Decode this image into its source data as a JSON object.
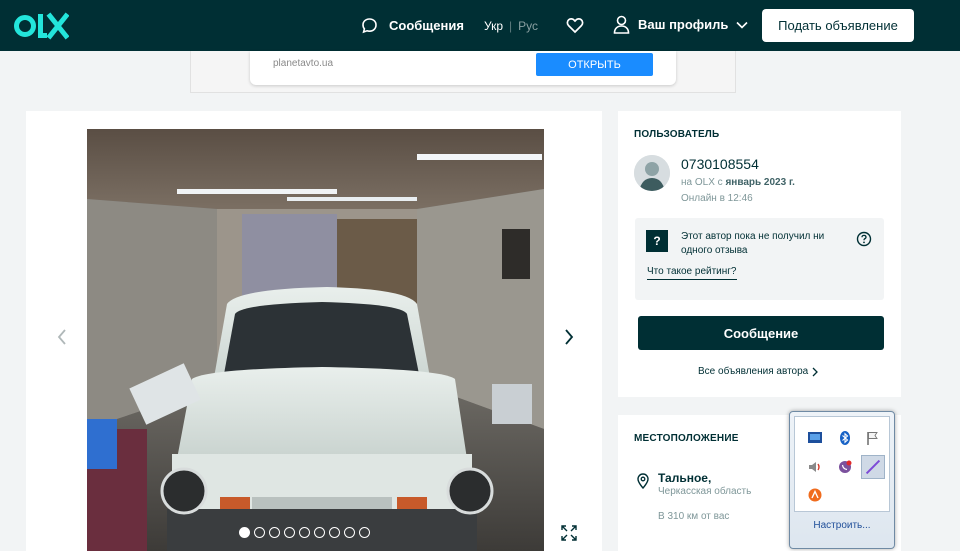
{
  "header": {
    "logo_text": "OLX",
    "messages_label": "Сообщения",
    "lang_ukr": "Укр",
    "lang_sep": "|",
    "lang_rus": "Рус",
    "profile_label": "Ваш профиль",
    "post_ad_label": "Подать объявление"
  },
  "ad_banner": {
    "site": "planetavto.ua",
    "open_label": "ОТКРЫТЬ"
  },
  "gallery": {
    "photo_count": 9,
    "active_index": 0
  },
  "user_card": {
    "title": "ПОЛЬЗОВАТЕЛЬ",
    "phone": "0730108554",
    "since_prefix": "на OLX с",
    "since_date": "январь 2023 г.",
    "online": "Онлайн в 12:46",
    "rating_badge": "?",
    "rating_text": "Этот автор пока не получил ни одного отзыва",
    "rating_link": "Что такое рейтинг?",
    "message_label": "Сообщение",
    "all_ads_label": "Все объявления автора"
  },
  "location_card": {
    "title": "МЕСТОПОЛОЖЕНИЕ",
    "city": "Тальное,",
    "region": "Черкасская область",
    "distance": "В 310 км от вас"
  },
  "tray": {
    "configure_label": "Настроить..."
  },
  "colors": {
    "brand_dark": "#002f34",
    "brand_teal": "#23e5db",
    "ad_button": "#1a8cff"
  }
}
